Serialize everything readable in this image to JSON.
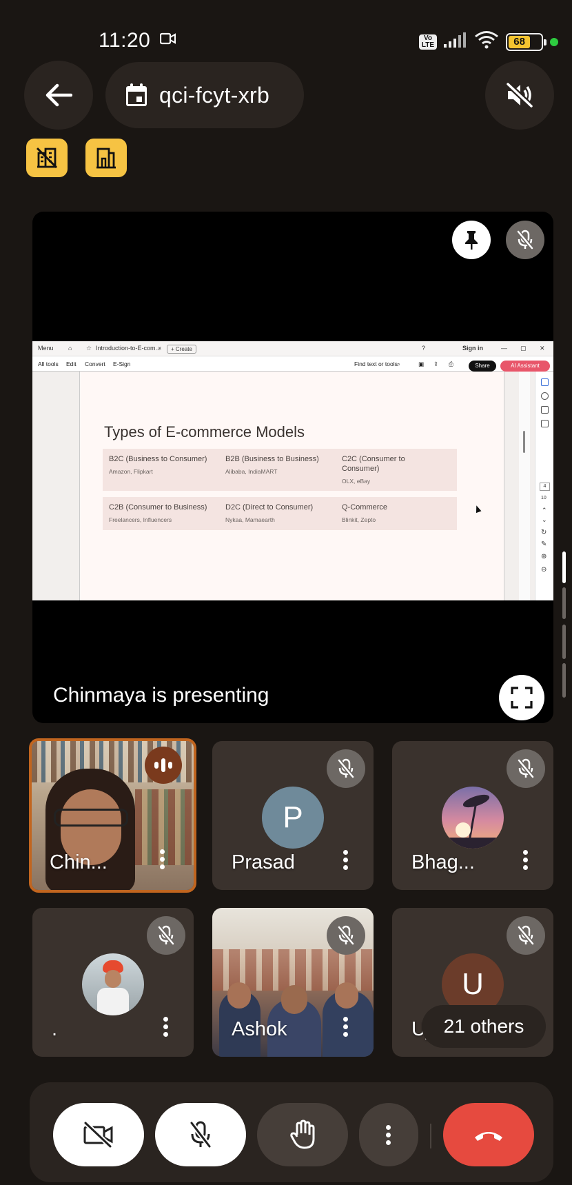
{
  "status_bar": {
    "time": "11:20",
    "volte_label": "Vo LTE",
    "battery_level": "68",
    "icons": [
      "video-record-icon",
      "volte-icon",
      "signal-icon",
      "wifi-icon",
      "battery-icon",
      "camera-in-use-dot"
    ]
  },
  "top_bar": {
    "back_icon": "arrow-left-icon",
    "meeting_icon": "calendar-event-icon",
    "meeting_code": "qci-fcyt-xrb",
    "audio_icon": "speaker-off-icon"
  },
  "chips": [
    {
      "icon": "no-buildings-icon",
      "color": "#f6c343"
    },
    {
      "icon": "building-door-icon",
      "color": "#f6c343"
    }
  ],
  "presentation": {
    "label": "Chinmaya is presenting",
    "pin_icon": "pin-icon",
    "mic_icon": "mic-off-icon",
    "fullscreen_icon": "fullscreen-icon",
    "shared_screen": {
      "menu": "Menu",
      "tab_title": "Introduction-to-E-com...",
      "tab_close": "×",
      "new_tab": "+ Create",
      "sign_in": "Sign in",
      "window_controls": [
        "—",
        "▢",
        "✕"
      ],
      "toolbar_items": [
        "All tools",
        "Edit",
        "Convert",
        "E-Sign"
      ],
      "search_placeholder": "Find text or tools",
      "share": "Share",
      "ai_assistant": "AI Assistant",
      "page_numbers": [
        "4",
        "10"
      ],
      "doc_title": "Types of E-commerce Models",
      "models": [
        {
          "name": "B2C (Business to Consumer)",
          "examples": "Amazon, Flipkart"
        },
        {
          "name": "B2B (Business to Business)",
          "examples": "Alibaba, IndiaMART"
        },
        {
          "name": "C2C (Consumer to Consumer)",
          "examples": "OLX, eBay"
        },
        {
          "name": "C2B (Consumer to Business)",
          "examples": "Freelancers, Influencers"
        },
        {
          "name": "D2C (Direct to Consumer)",
          "examples": "Nykaa, Mamaearth"
        },
        {
          "name": "Q-Commerce",
          "examples": "Blinkit, Zepto"
        }
      ]
    }
  },
  "participants": [
    {
      "name": "Chin...",
      "type": "video",
      "state": "speaking"
    },
    {
      "name": "Prasad",
      "type": "letter",
      "letter": "P",
      "avatar_color": "#6f8a9a",
      "state": "muted"
    },
    {
      "name": "Bhag...",
      "type": "photo",
      "state": "muted"
    },
    {
      "name": ".",
      "type": "photo",
      "state": "muted"
    },
    {
      "name": "Ashok",
      "type": "video",
      "state": "muted"
    },
    {
      "name": "Ujjval",
      "type": "letter",
      "letter": "U",
      "avatar_color": "#6b3c2a",
      "state": "muted"
    }
  ],
  "others_label": "21 others",
  "controls": {
    "camera_icon": "camera-off-icon",
    "mic_icon": "mic-off-icon",
    "hand_icon": "raise-hand-icon",
    "more_icon": "more-vertical-icon",
    "leave_icon": "phone-hangup-icon",
    "leave_color": "#e64a3f"
  }
}
